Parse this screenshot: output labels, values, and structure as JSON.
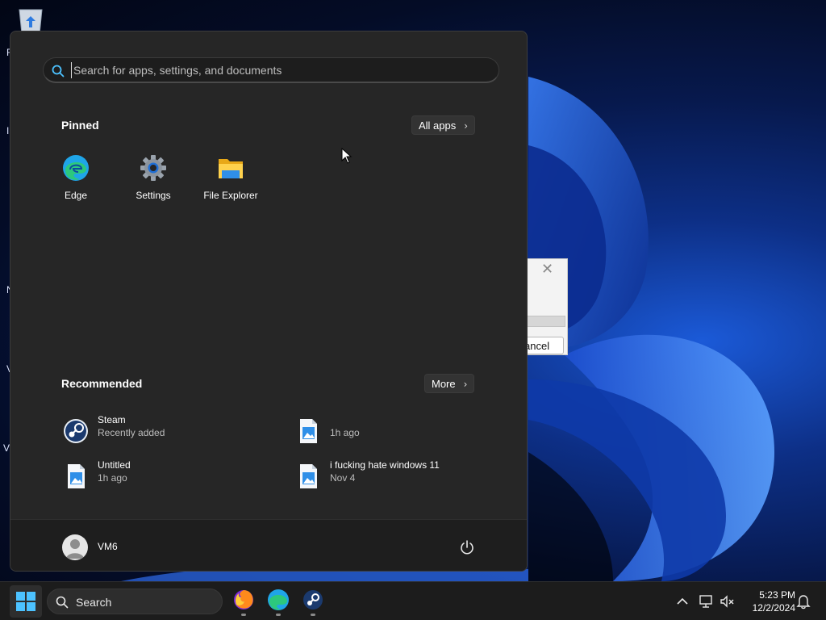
{
  "desktop": {
    "icon_name": "recycle-bin-icon",
    "edge_letters": [
      "R",
      "I",
      "N",
      "V",
      "V"
    ],
    "background_dialog": {
      "close_glyph": "✕",
      "button_label": "ancel"
    }
  },
  "start_menu": {
    "search": {
      "placeholder": "Search for apps, settings, and documents"
    },
    "pinned": {
      "title": "Pinned",
      "all_apps_label": "All apps",
      "apps": [
        {
          "label": "Edge",
          "icon": "edge-icon"
        },
        {
          "label": "Settings",
          "icon": "settings-gear-icon"
        },
        {
          "label": "File Explorer",
          "icon": "folder-icon"
        }
      ]
    },
    "recommended": {
      "title": "Recommended",
      "more_label": "More",
      "items": [
        {
          "name": "Steam",
          "sub": "Recently added",
          "icon": "steam-icon"
        },
        {
          "name": "",
          "sub": "1h ago",
          "icon": "image-file-icon"
        },
        {
          "name": "Untitled",
          "sub": "1h ago",
          "icon": "image-file-icon"
        },
        {
          "name": "i fucking hate windows 11",
          "sub": "Nov 4",
          "icon": "image-file-icon"
        }
      ]
    },
    "user": {
      "name": "VM6"
    },
    "power_icon": "power-icon"
  },
  "taskbar": {
    "search_label": "Search",
    "apps": [
      "firefox-icon",
      "edge-icon",
      "steam-icon"
    ],
    "tray": [
      "chevron-up-icon",
      "network-icon",
      "volume-muted-icon",
      "notification-bell-icon"
    ],
    "clock": {
      "time": "5:23 PM",
      "date": "12/2/2024"
    }
  },
  "colors": {
    "menu_bg": "#262626",
    "menu_footer_bg": "#1e1e1e",
    "taskbar_bg": "#1c1c1c",
    "accent": "#0078d4",
    "wallpaper_blue": "#1b5ad8"
  }
}
